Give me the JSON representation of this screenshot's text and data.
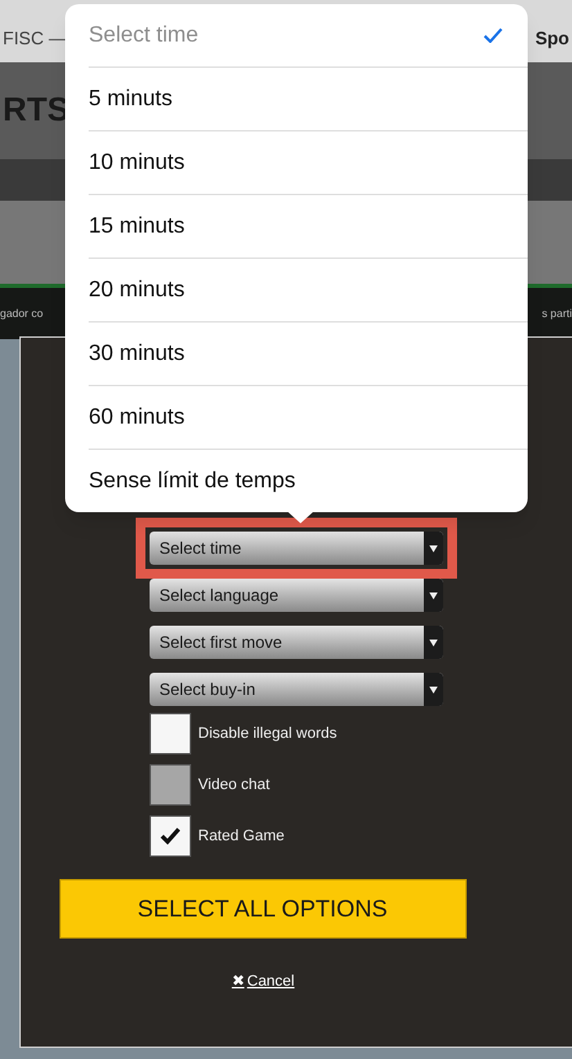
{
  "background": {
    "tab_left": "FISC —",
    "tab_right": "Spo",
    "logo": "RTS",
    "text_left": "gador co",
    "text_right": "s parti"
  },
  "picker": {
    "options": [
      {
        "label": "Select time",
        "selected": true
      },
      {
        "label": "5 minuts",
        "selected": false
      },
      {
        "label": "10 minuts",
        "selected": false
      },
      {
        "label": "15 minuts",
        "selected": false
      },
      {
        "label": "20 minuts",
        "selected": false
      },
      {
        "label": "30 minuts",
        "selected": false
      },
      {
        "label": "60 minuts",
        "selected": false
      },
      {
        "label": "Sense límit de temps",
        "selected": false
      }
    ]
  },
  "dialog": {
    "selects": [
      {
        "value": "Select time",
        "highlighted": true
      },
      {
        "value": "Select language",
        "highlighted": false
      },
      {
        "value": "Select first move",
        "highlighted": false
      },
      {
        "value": "Select buy-in",
        "highlighted": false
      }
    ],
    "checkboxes": [
      {
        "label": "Disable illegal words",
        "checked": false,
        "disabled": false
      },
      {
        "label": "Video chat",
        "checked": false,
        "disabled": true
      },
      {
        "label": "Rated Game",
        "checked": true,
        "disabled": false
      }
    ],
    "submit": "SELECT ALL OPTIONS",
    "cancel_icon": "✖",
    "cancel": "Cancel"
  }
}
